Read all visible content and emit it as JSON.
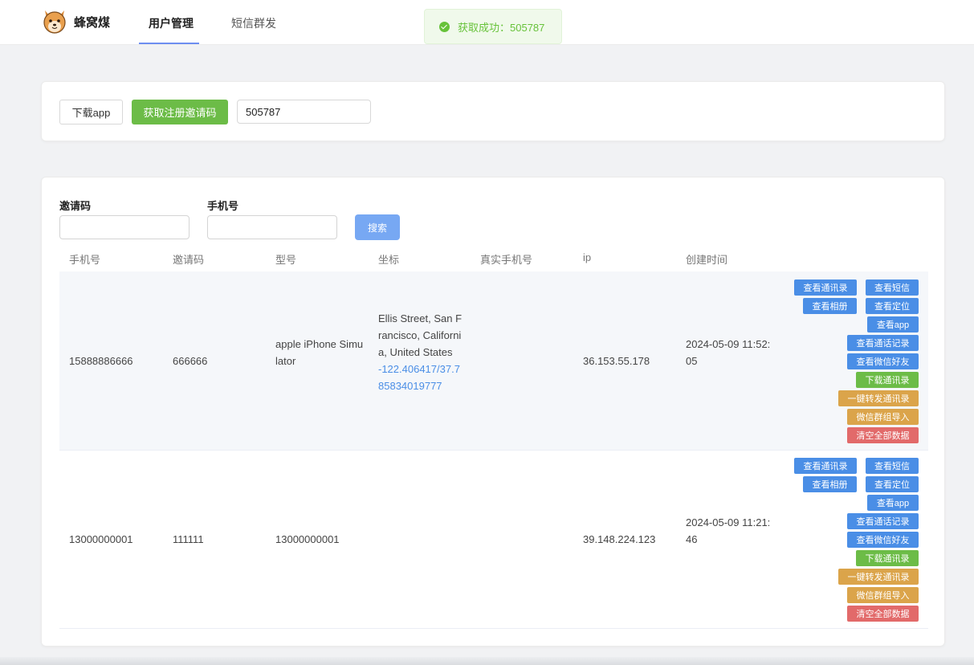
{
  "header": {
    "brand": "蜂窝煤",
    "logo_icon": "shiba-dog-logo-icon",
    "nav": [
      {
        "label": "用户管理",
        "active": true
      },
      {
        "label": "短信群发",
        "active": false
      }
    ]
  },
  "toast": {
    "text": "获取成功：505787",
    "icon": "check-circle-icon",
    "color": "#67c23a"
  },
  "toolbar": {
    "download_label": "下载app",
    "get_code_label": "获取注册邀请码",
    "code_value": "505787"
  },
  "filters": {
    "invite_label": "邀请码",
    "phone_label": "手机号",
    "invite_value": "",
    "phone_value": "",
    "search_label": "搜索"
  },
  "table": {
    "columns": [
      "手机号",
      "邀请码",
      "型号",
      "坐标",
      "真实手机号",
      "ip",
      "创建时间"
    ],
    "rows": [
      {
        "phone": "15888886666",
        "invite": "666666",
        "model": "apple iPhone Simulator",
        "address": "Ellis Street, San Francisco, California, United States",
        "coords": "-122.406417/37.785834019777",
        "real_phone": "",
        "ip": "36.153.55.178",
        "created": "2024-05-09 11:52:05"
      },
      {
        "phone": "13000000001",
        "invite": "111111",
        "model": "13000000001",
        "address": "",
        "coords": "",
        "real_phone": "",
        "ip": "39.148.224.123",
        "created": "2024-05-09 11:21:46"
      }
    ],
    "actions": {
      "view_contacts": "查看通讯录",
      "view_sms": "查看短信",
      "view_album": "查看相册",
      "view_location": "查看定位",
      "view_app": "查看app",
      "view_call_log": "查看通话记录",
      "view_wechat_friends": "查看微信好友",
      "download_contacts": "下载通讯录",
      "forward_contacts": "一键转发通讯录",
      "import_wechat_group": "微信群组导入",
      "clear_all": "清空全部数据"
    }
  },
  "colors": {
    "primary": "#4a8ee6",
    "success": "#6cbc47",
    "warning": "#dba44a",
    "danger": "#e26a6a",
    "search": "#77a8f3",
    "nav_underline": "#6d8ef0"
  }
}
